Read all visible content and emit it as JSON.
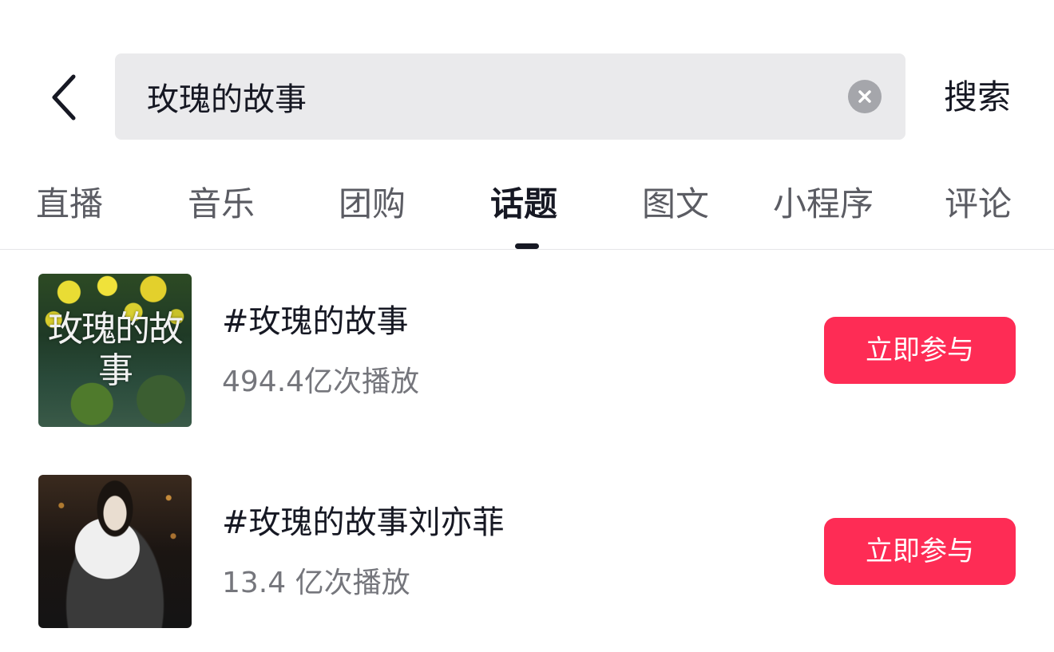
{
  "search": {
    "query": "玫瑰的故事",
    "submit_label": "搜索"
  },
  "icons": {
    "back": "chevron-left-icon",
    "clear": "clear-x-icon"
  },
  "tabs": [
    {
      "label": "直播",
      "active": false
    },
    {
      "label": "音乐",
      "active": false
    },
    {
      "label": "团购",
      "active": false
    },
    {
      "label": "话题",
      "active": true
    },
    {
      "label": "图文",
      "active": false
    },
    {
      "label": "小程序",
      "active": false
    },
    {
      "label": "评论",
      "active": false
    }
  ],
  "results": [
    {
      "thumbnail_text": "玫瑰的故事",
      "title": "#玫瑰的故事",
      "plays": "494.4亿次播放",
      "action_label": "立即参与"
    },
    {
      "title": "#玫瑰的故事刘亦菲",
      "plays": "13.4 亿次播放",
      "action_label": "立即参与"
    }
  ],
  "colors": {
    "accent": "#fe2c55",
    "text_primary": "#161823",
    "text_secondary": "#75767c",
    "search_bg": "#eaeaec"
  }
}
